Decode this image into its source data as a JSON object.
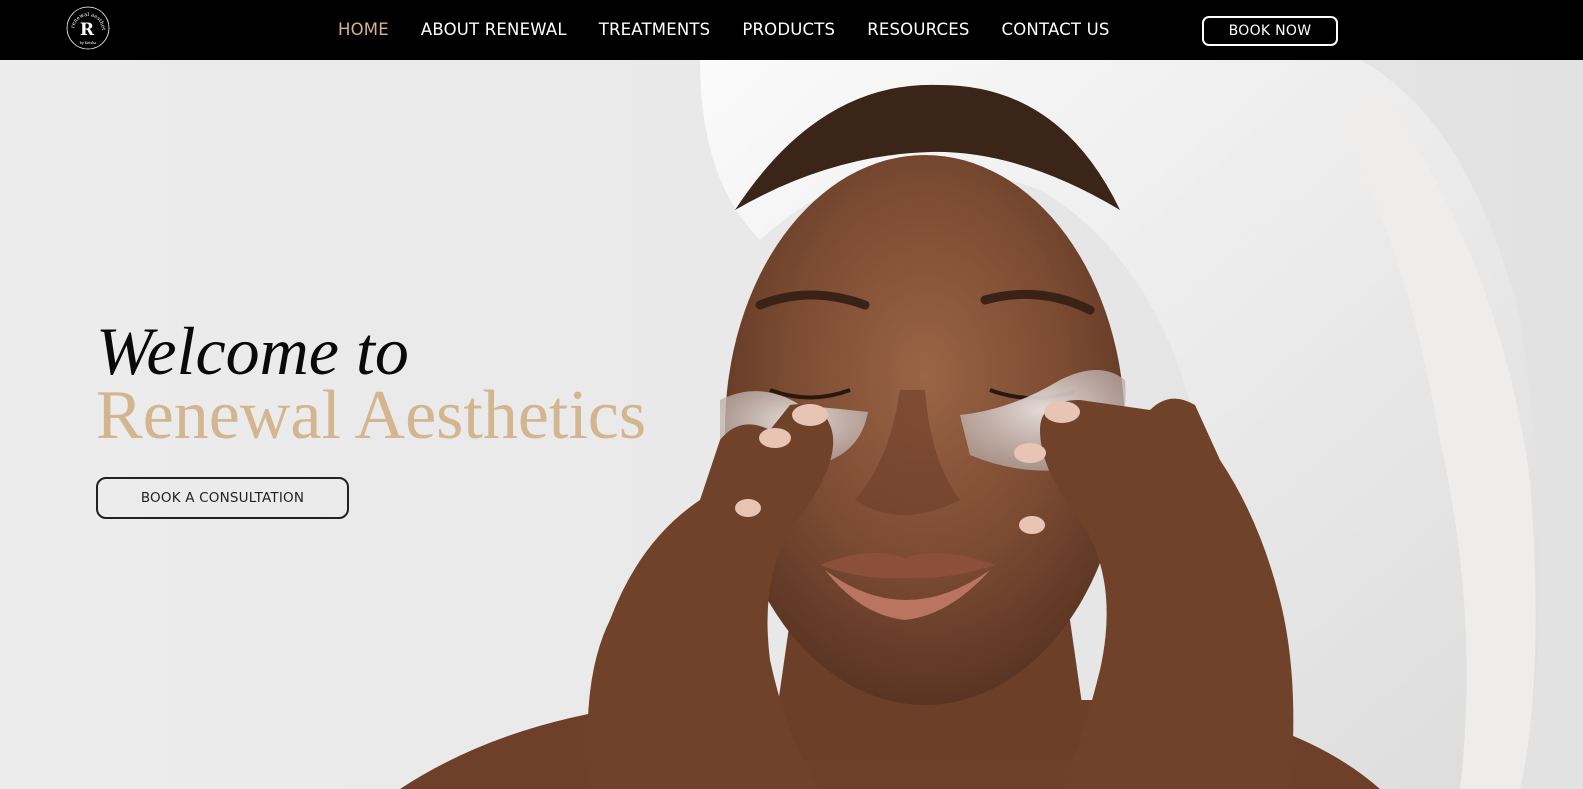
{
  "brand": {
    "logo_letter": "R",
    "logo_ring_text": "renewal aesthetics",
    "logo_sub_text": "by Keisha"
  },
  "nav": {
    "items": [
      {
        "label": "HOME",
        "active": true
      },
      {
        "label": "ABOUT RENEWAL",
        "active": false
      },
      {
        "label": "TREATMENTS",
        "active": false
      },
      {
        "label": "PRODUCTS",
        "active": false
      },
      {
        "label": "RESOURCES",
        "active": false
      },
      {
        "label": "CONTACT US",
        "active": false
      }
    ],
    "book_now_label": "BOOK NOW"
  },
  "hero": {
    "welcome": "Welcome to",
    "title": "Renewal Aesthetics",
    "cta_label": "BOOK A CONSULTATION",
    "image_subject": "woman-applying-under-eye-gel-patches"
  },
  "colors": {
    "nav_background": "#000000",
    "accent_gold": "#d3b58f",
    "hero_background": "#ececec",
    "text_dark": "#0a0a0a"
  }
}
